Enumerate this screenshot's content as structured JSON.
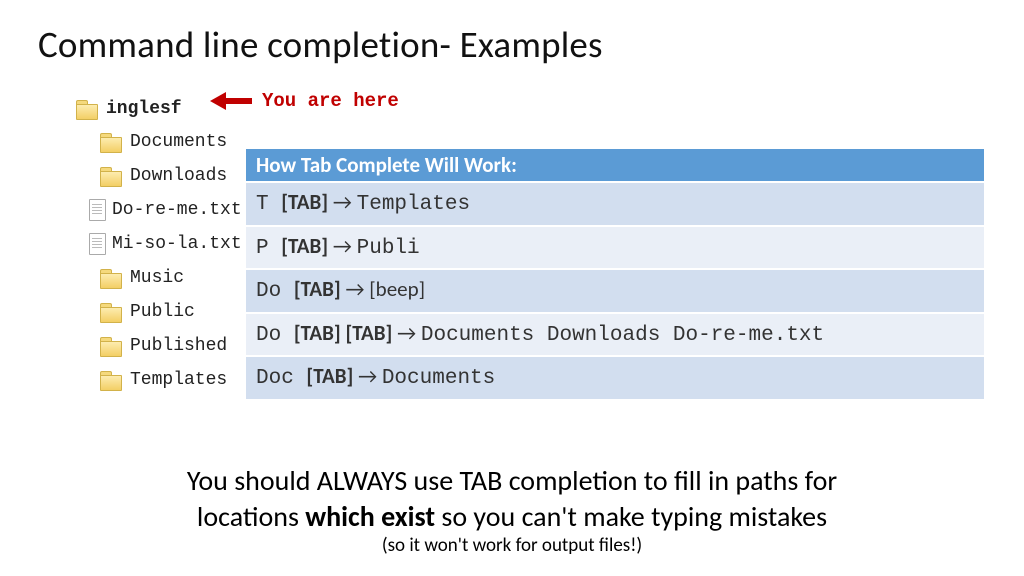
{
  "title": "Command line completion- Examples",
  "here_label": "You are here",
  "tree": {
    "root": "inglesf",
    "items": [
      {
        "type": "folder",
        "name": "Documents"
      },
      {
        "type": "folder",
        "name": "Downloads"
      },
      {
        "type": "file",
        "name": "Do-re-me.txt"
      },
      {
        "type": "file",
        "name": "Mi-so-la.txt"
      },
      {
        "type": "folder",
        "name": "Music"
      },
      {
        "type": "folder",
        "name": "Public"
      },
      {
        "type": "folder",
        "name": "Published"
      },
      {
        "type": "folder",
        "name": "Templates"
      }
    ]
  },
  "table": {
    "header": "How Tab Complete Will Work:",
    "tab_token": "[TAB]",
    "arrow_token": "→",
    "rows": [
      {
        "prefix": "T",
        "tabs": 1,
        "result_type": "mono",
        "result": "Templates"
      },
      {
        "prefix": "P",
        "tabs": 1,
        "result_type": "mono",
        "result": "Publi"
      },
      {
        "prefix": "Do",
        "tabs": 1,
        "result_type": "plain",
        "result": "[beep]"
      },
      {
        "prefix": "Do",
        "tabs": 2,
        "result_type": "mono",
        "result": "Documents Downloads  Do-re-me.txt"
      },
      {
        "prefix": "Doc",
        "tabs": 1,
        "result_type": "mono",
        "result": "Documents"
      }
    ]
  },
  "footer": {
    "line1_a": "You should ALWAYS use TAB completion to fill in paths for",
    "line2_a": "locations ",
    "line2_b": "which exist",
    "line2_c": " so you can't make typing mistakes",
    "line3": "(so it won't work for output files!)"
  }
}
